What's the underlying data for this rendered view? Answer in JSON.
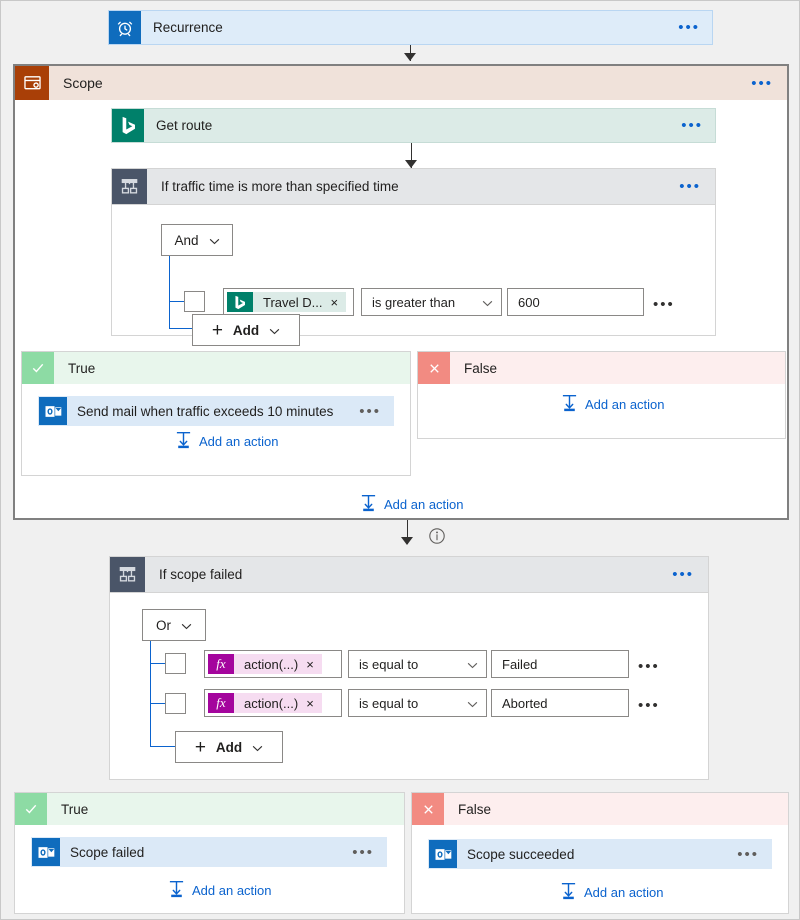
{
  "workflow": {
    "trigger": {
      "label": "Recurrence",
      "icon": "alarm-clock-icon",
      "menu": "•••"
    },
    "scope": {
      "label": "Scope",
      "icon": "scope-icon",
      "menu": "•••",
      "action": {
        "label": "Get route",
        "icon": "bing-maps-icon",
        "menu": "•••"
      },
      "condition": {
        "label": "If traffic time is more than specified time",
        "icon": "condition-icon",
        "menu": "•••",
        "operator": "And",
        "chevron": "∨",
        "rows": [
          {
            "token": "Travel D...",
            "token_icon": "bing-maps-icon",
            "token_remove": "×",
            "comparison": "is greater than",
            "value": "600",
            "menu": "•••"
          }
        ],
        "add_button": "Add",
        "add_plus": "+"
      },
      "branch_true": {
        "label": "True",
        "icon": "check-icon",
        "action": {
          "label": "Send mail when traffic exceeds 10 minutes",
          "icon": "outlook-icon",
          "menu": "•••"
        },
        "add_action": "Add an action"
      },
      "branch_false": {
        "label": "False",
        "icon": "cross-icon",
        "add_action": "Add an action"
      },
      "add_action": "Add an action"
    },
    "info_icon": "info-icon",
    "scope_failed_condition": {
      "label": "If scope failed",
      "icon": "condition-icon",
      "menu": "•••",
      "operator": "Or",
      "chevron": "∨",
      "rows": [
        {
          "token": "action(...)",
          "token_icon": "function-icon",
          "token_glyph": "fx",
          "token_remove": "×",
          "comparison": "is equal to",
          "value": "Failed",
          "menu": "•••"
        },
        {
          "token": "action(...)",
          "token_icon": "function-icon",
          "token_glyph": "fx",
          "token_remove": "×",
          "comparison": "is equal to",
          "value": "Aborted",
          "menu": "•••"
        }
      ],
      "add_button": "Add",
      "add_plus": "+"
    },
    "bottom_branch_true": {
      "label": "True",
      "icon": "check-icon",
      "action": {
        "label": "Scope failed",
        "icon": "outlook-icon",
        "menu": "•••"
      },
      "add_action": "Add an action"
    },
    "bottom_branch_false": {
      "label": "False",
      "icon": "cross-icon",
      "action": {
        "label": "Scope succeeded",
        "icon": "outlook-icon",
        "menu": "•••"
      },
      "add_action": "Add an action"
    }
  },
  "colors": {
    "trigger_blue": "#0f6cbd",
    "card_blue": "#deecf9",
    "scope_brown": "#a93f07",
    "scope_header": "#f0e2da",
    "bing_teal": "#00806a",
    "condition_grey": "#4a5568",
    "true_green": "#8ddba4",
    "false_red": "#f28b82",
    "link_blue": "#0b63ce",
    "function_magenta": "#a4059d"
  }
}
